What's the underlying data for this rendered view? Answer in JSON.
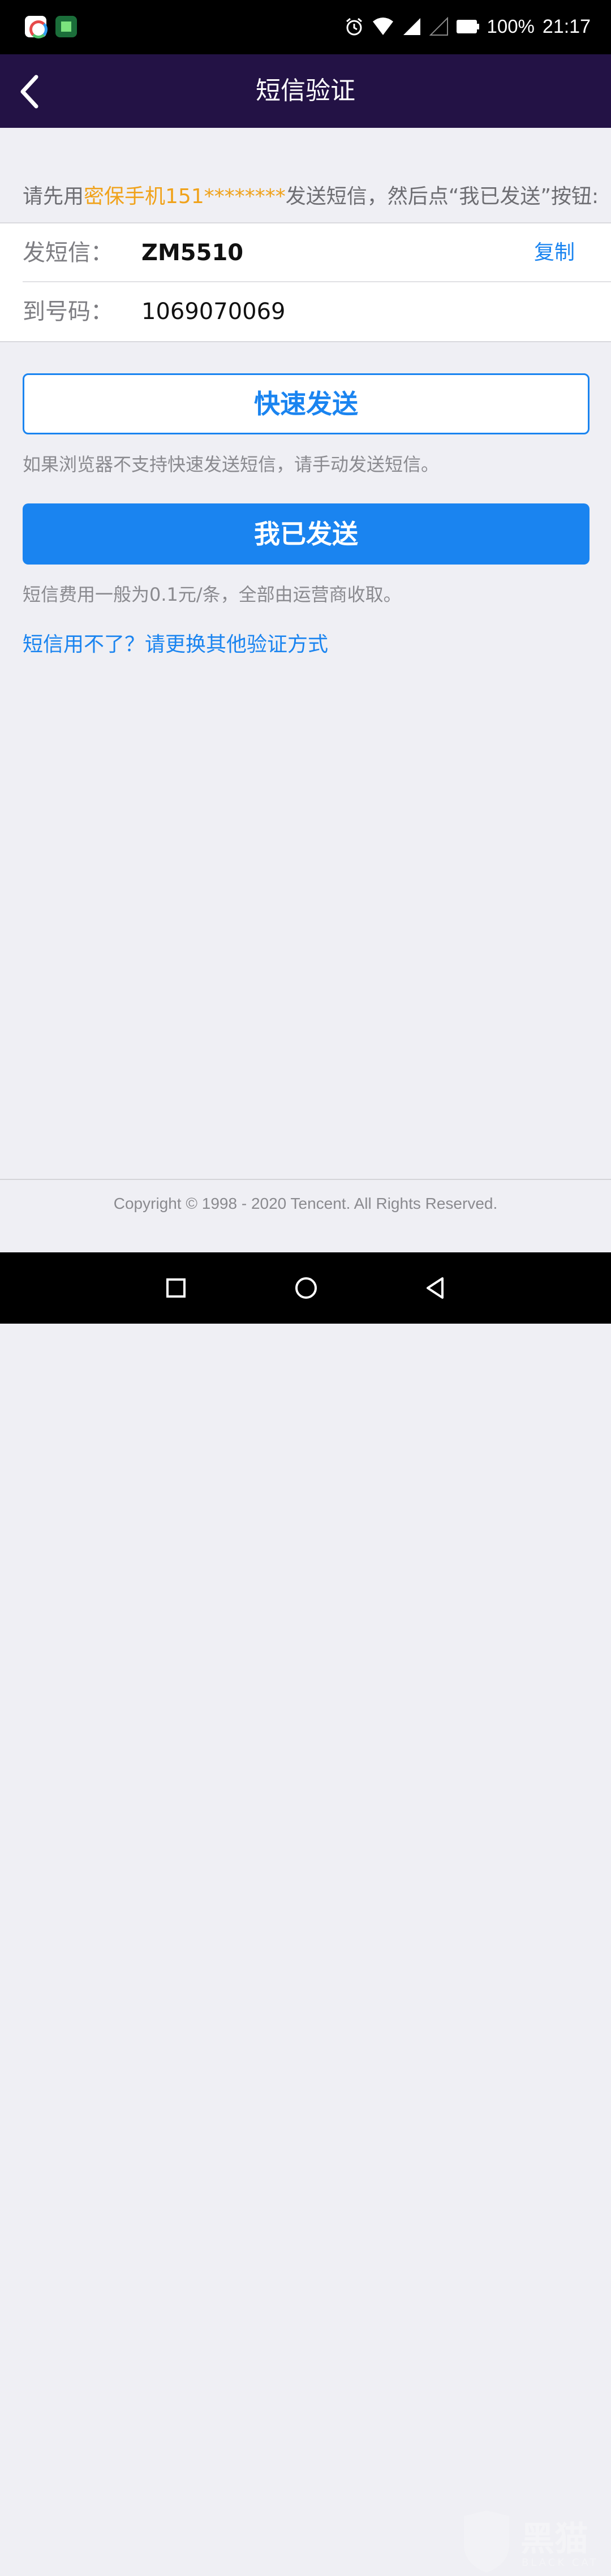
{
  "status_bar": {
    "battery": "100%",
    "time": "21:17"
  },
  "header": {
    "title": "短信验证"
  },
  "instruction": {
    "prefix": "请先用",
    "highlight": "密保手机151********",
    "suffix": "发送短信，然后点“我已发送”按钮:"
  },
  "sms": {
    "send_label": "发短信：",
    "send_value": "ZM5510",
    "copy_label": "复制",
    "to_label": "到号码：",
    "to_value": "1069070069"
  },
  "actions": {
    "quick_send": "快速发送",
    "quick_note": "如果浏览器不支持快速发送短信，请手动发送短信。",
    "sent": "我已发送",
    "fee_note": "短信费用一般为0.1元/条，全部由运营商收取。",
    "alt_link": "短信用不了？请更换其他验证方式"
  },
  "footer": {
    "copyright": "Copyright © 1998 - 2020 Tencent. All Rights Reserved."
  },
  "watermark": {
    "text": "黑猫",
    "sub": "BLACK CAT"
  },
  "icons": {
    "back": "chevron-left-icon",
    "recent": "square-icon",
    "home": "circle-icon",
    "nav_back": "triangle-left-icon"
  },
  "colors": {
    "header_bg": "#231245",
    "accent_blue": "#1a84f0",
    "highlight_orange": "#f0a21a",
    "page_bg": "#efeff4"
  }
}
